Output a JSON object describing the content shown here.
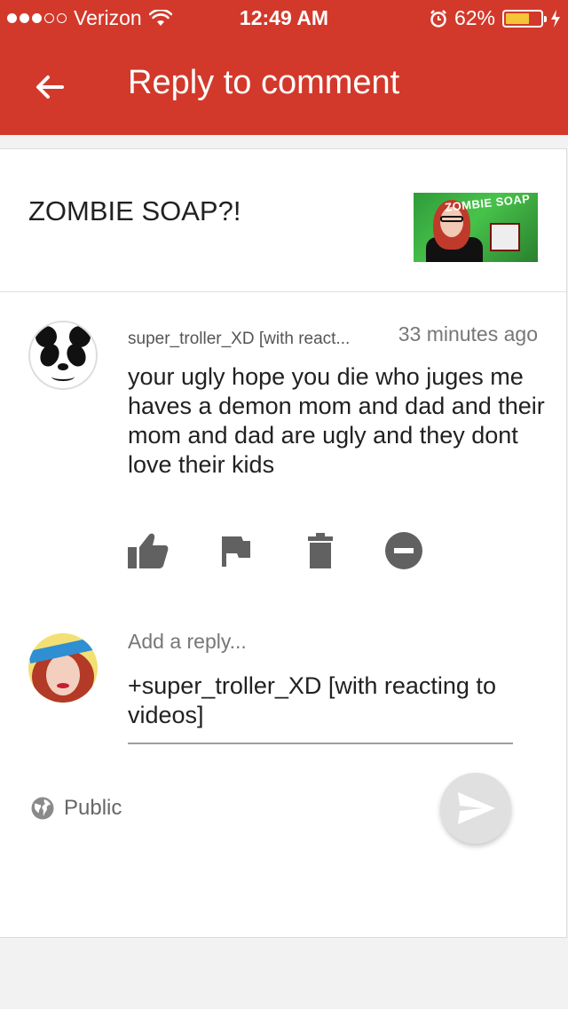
{
  "status_bar": {
    "carrier": "Verizon",
    "time": "12:49 AM",
    "battery_percent": "62%",
    "battery_level": 0.62,
    "signal_bars_filled": 3,
    "signal_bars_total": 5
  },
  "header": {
    "title": "Reply to comment",
    "back_icon": "arrow-left-icon",
    "color": "#d2392b"
  },
  "video": {
    "title": "ZOMBIE SOAP?!",
    "thumbnail_text": "ZOMBIE SOAP"
  },
  "comment": {
    "username": "super_troller_XD [with react...",
    "timestamp": "33 minutes ago",
    "text": "your ugly hope you die who juges me haves a demon mom and dad and their mom and dad are ugly and they dont love their kids",
    "actions": [
      "thumbs-up-icon",
      "flag-icon",
      "trash-icon",
      "block-icon"
    ]
  },
  "reply": {
    "label": "Add a reply...",
    "value": "+super_troller_XD [with reacting to videos]"
  },
  "visibility": {
    "label": "Public",
    "icon": "globe-icon"
  },
  "send_icon": "send-icon"
}
